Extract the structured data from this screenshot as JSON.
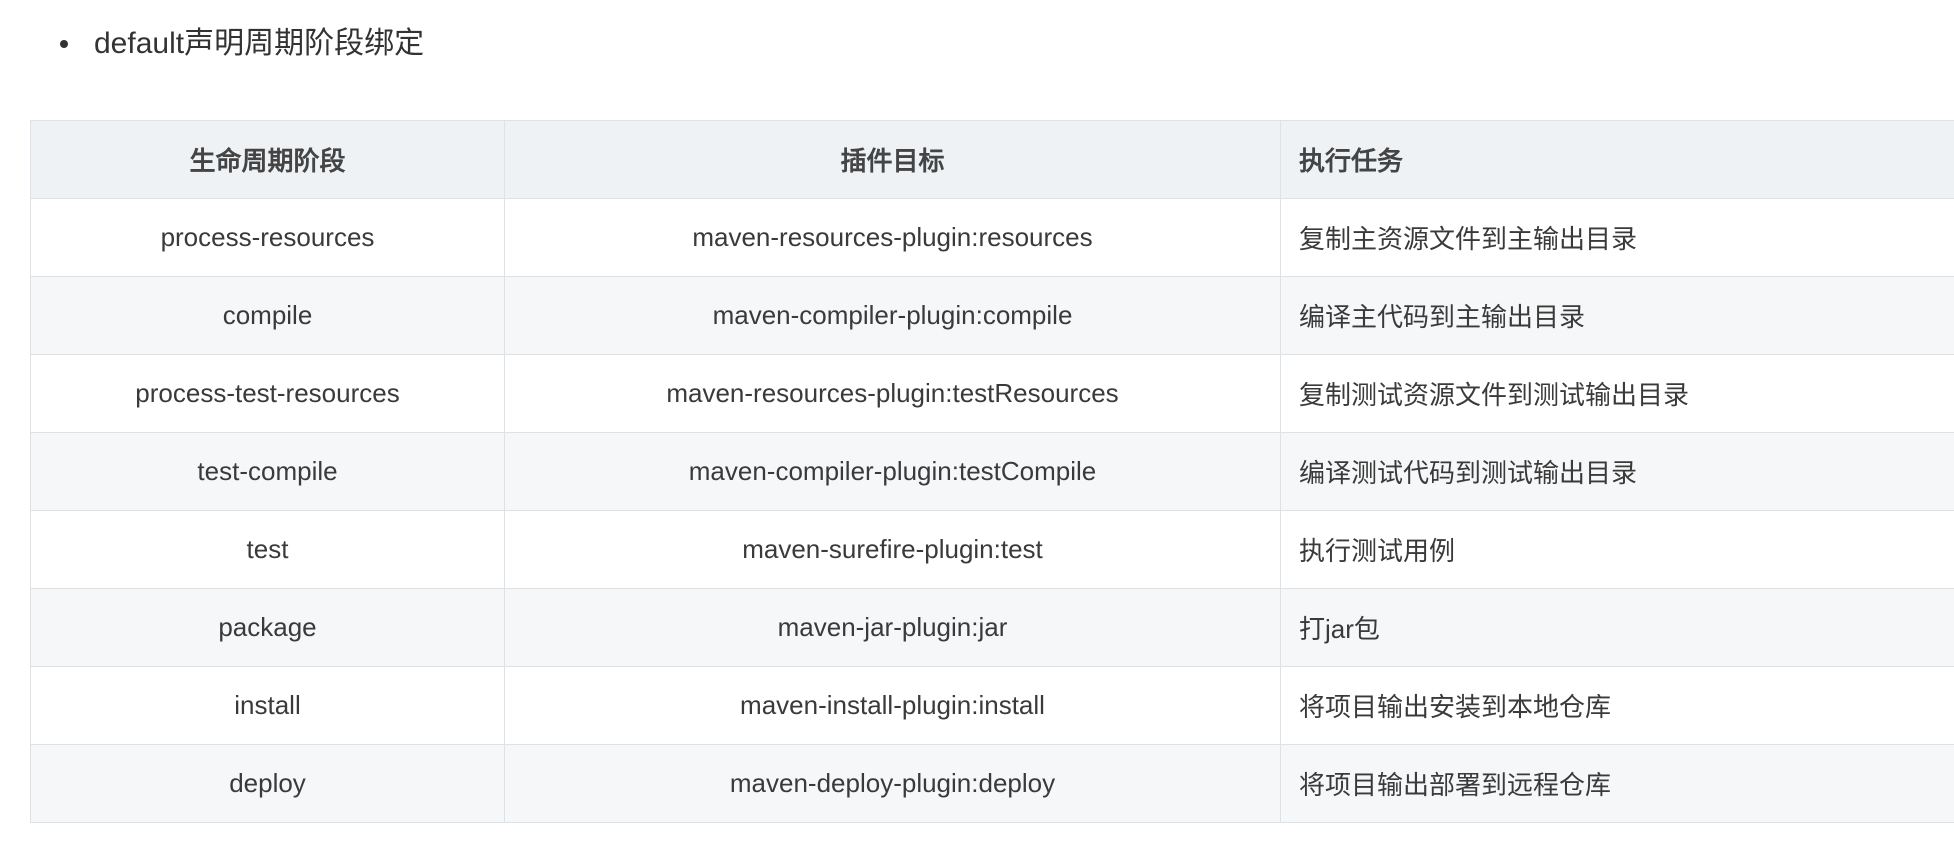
{
  "section": {
    "bullet_text": "default声明周期阶段绑定"
  },
  "table": {
    "headers": [
      "生命周期阶段",
      "插件目标",
      "执行任务"
    ],
    "rows": [
      [
        "process-resources",
        "maven-resources-plugin:resources",
        "复制主资源文件到主输出目录"
      ],
      [
        "compile",
        "maven-compiler-plugin:compile",
        "编译主代码到主输出目录"
      ],
      [
        "process-test-resources",
        "maven-resources-plugin:testResources",
        "复制测试资源文件到测试输出目录"
      ],
      [
        "test-compile",
        "maven-compiler-plugin:testCompile",
        "编译测试代码到测试输出目录"
      ],
      [
        "test",
        "maven-surefire-plugin:test",
        "执行测试用例"
      ],
      [
        "package",
        "maven-jar-plugin:jar",
        "打jar包"
      ],
      [
        "install",
        "maven-install-plugin:install",
        "将项目输出安装到本地仓库"
      ],
      [
        "deploy",
        "maven-deploy-plugin:deploy",
        "将项目输出部署到远程仓库"
      ]
    ]
  },
  "colors": {
    "header_bg": "#eef2f5",
    "row_alt_bg": "#f6f7f8",
    "border": "#dde2e6",
    "text": "#333333"
  }
}
